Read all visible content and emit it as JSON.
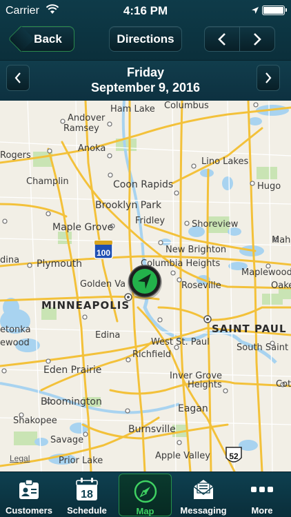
{
  "status_bar": {
    "carrier": "Carrier",
    "time": "4:16 PM"
  },
  "nav": {
    "back_label": "Back",
    "directions_label": "Directions"
  },
  "date": {
    "weekday": "Friday",
    "full_date": "September 9, 2016"
  },
  "map": {
    "legal": "Legal",
    "cities": [
      "Ham Lake",
      "Columbus",
      "Andover",
      "Ramsey",
      "Anoka",
      "Lino Lakes",
      "Rogers",
      "Champlin",
      "Coon Rapids",
      "Hugo",
      "Brooklyn Park",
      "Maple Grove",
      "Fridley",
      "Shoreview",
      "Mah",
      "New Brighton",
      "dina",
      "Plymouth",
      "Columbia Heights",
      "Maplewood",
      "Golden Va",
      "Roseville",
      "Oake",
      "MINNEAPOLIS",
      "SAINT PAUL",
      "etonka",
      "Edina",
      "West St. Paul",
      "South Saint",
      "ewood",
      "Richfield",
      "Eden Prairie",
      "Inver Grove",
      "Heights",
      "Cot",
      "Bloomington",
      "Eagan",
      "Shakopee",
      "Burnsville",
      "Savage",
      "Prior Lake",
      "Apple Valley"
    ],
    "shields": [
      "100",
      "52"
    ]
  },
  "tabs": [
    {
      "label": "Customers",
      "icon": "customers-icon"
    },
    {
      "label": "Schedule",
      "icon": "calendar-icon",
      "calendar_day": "18"
    },
    {
      "label": "Map",
      "icon": "compass-icon",
      "active": true
    },
    {
      "label": "Messaging",
      "icon": "envelope-icon"
    },
    {
      "label": "More",
      "icon": "more-dots-icon"
    }
  ],
  "colors": {
    "bar_background": "#0e3b49",
    "accent_green": "#3fd162",
    "map_road": "#f5c542",
    "map_water": "#a8d3f0",
    "map_park": "#c6e3b0"
  }
}
